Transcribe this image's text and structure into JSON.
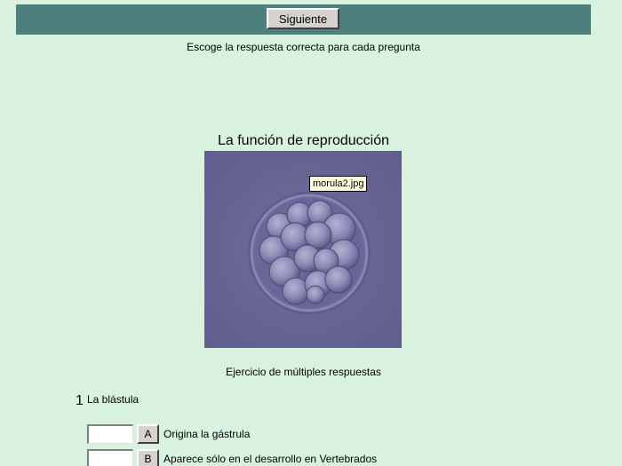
{
  "toolbar": {
    "next_label": "Siguiente"
  },
  "instructions": "Escoge la respuesta correcta para cada pregunta",
  "title": "La función de reproducción",
  "image": {
    "tooltip": "morula2.jpg"
  },
  "exercise_subtitle": "Ejercicio de múltiples respuestas",
  "question": {
    "number": "1",
    "text": "La blástula",
    "answers": [
      {
        "letter": "A",
        "text": "Origina la gástrula",
        "value": ""
      },
      {
        "letter": "B",
        "text": "Aparece sólo en el desarrollo en Vertebrados",
        "value": ""
      }
    ]
  },
  "colors": {
    "background": "#d9f2e0",
    "toolbar": "#4d7f7d",
    "button_face": "#d6d3ce",
    "tooltip": "#ffffe1"
  }
}
